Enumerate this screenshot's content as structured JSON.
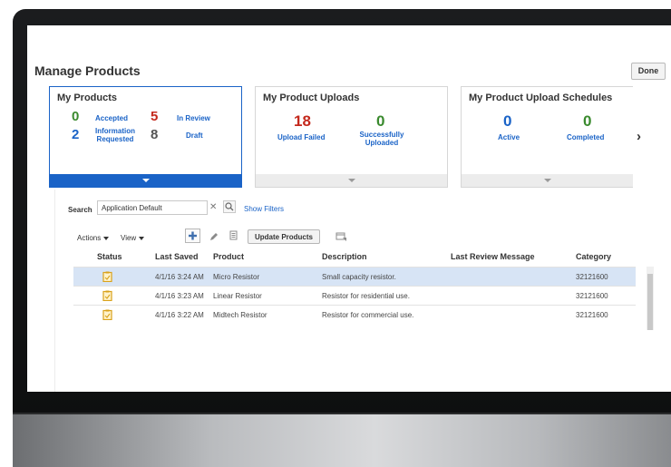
{
  "page": {
    "title": "Manage Products",
    "done_label": "Done"
  },
  "cards": {
    "my_products": {
      "title": "My Products",
      "accepted": {
        "count": "0",
        "label": "Accepted"
      },
      "in_review": {
        "count": "5",
        "label": "In Review"
      },
      "info_requested": {
        "count": "2",
        "label": "Information Requested"
      },
      "draft": {
        "count": "8",
        "label": "Draft"
      }
    },
    "uploads": {
      "title": "My Product Uploads",
      "failed": {
        "count": "18",
        "label": "Upload Failed"
      },
      "success": {
        "count": "0",
        "label": "Successfully Uploaded"
      }
    },
    "schedules": {
      "title": "My Product Upload Schedules",
      "active": {
        "count": "0",
        "label": "Active"
      },
      "completed": {
        "count": "0",
        "label": "Completed"
      }
    }
  },
  "search": {
    "label": "Search",
    "value": "Application Default",
    "show_filters": "Show Filters"
  },
  "toolbar": {
    "actions": "Actions",
    "view": "View",
    "update_products": "Update Products"
  },
  "table": {
    "columns": {
      "status": "Status",
      "last_saved": "Last Saved",
      "product": "Product",
      "description": "Description",
      "last_review": "Last Review Message",
      "category": "Category"
    },
    "rows": [
      {
        "last_saved": "4/1/16 3:24 AM",
        "product": "Micro Resistor",
        "description": "Small capacity resistor.",
        "last_review": "",
        "category": "32121600"
      },
      {
        "last_saved": "4/1/16 3:23 AM",
        "product": "Linear Resistor",
        "description": "Resistor for residential use.",
        "last_review": "",
        "category": "32121600"
      },
      {
        "last_saved": "4/1/16 3:22 AM",
        "product": "Midtech Resistor",
        "description": "Resistor for commercial use.",
        "last_review": "",
        "category": "32121600"
      }
    ]
  },
  "colors": {
    "accent": "#1a63c7",
    "green": "#3a8a2e",
    "red": "#c4281c",
    "selected_row": "#d7e4f5"
  }
}
